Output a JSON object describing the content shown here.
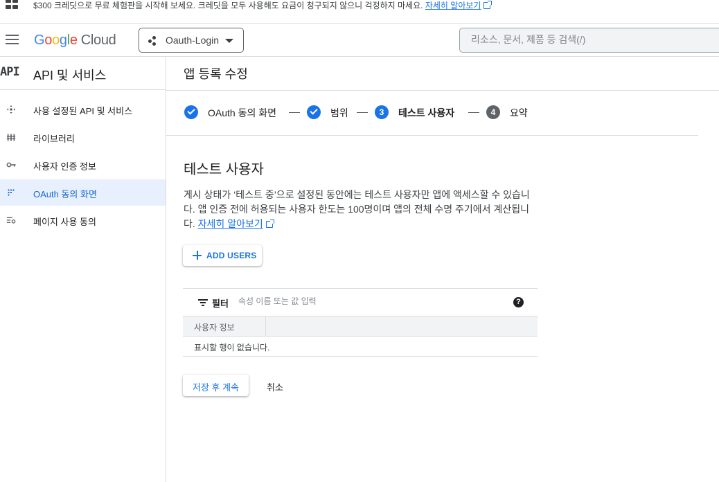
{
  "banner": {
    "text": "$300 크레딧으로 무료 체험판을 시작해 보세요. 크레딧을 모두 사용해도 요금이 청구되지 않으니 걱정하지 마세요.",
    "link": "자세히 알아보기"
  },
  "header": {
    "logo_google": [
      "G",
      "o",
      "o",
      "g",
      "l",
      "e"
    ],
    "logo_cloud": "Cloud",
    "project_name": "Oauth-Login",
    "search_placeholder": "리소스, 문서, 제품 등 검색(/)"
  },
  "sidebar": {
    "badge": "API",
    "title": "API 및 서비스",
    "items": [
      {
        "label": "사용 설정된 API 및 서비스",
        "icon": "api-services-icon"
      },
      {
        "label": "라이브러리",
        "icon": "library-icon"
      },
      {
        "label": "사용자 인증 정보",
        "icon": "key-icon"
      },
      {
        "label": "OAuth 동의 화면",
        "icon": "consent-screen-icon",
        "active": true
      },
      {
        "label": "페이지 사용 동의",
        "icon": "page-usage-icon"
      }
    ]
  },
  "main": {
    "title": "앱 등록 수정",
    "steps": [
      {
        "label": "OAuth 동의 화면",
        "state": "done"
      },
      {
        "label": "범위",
        "state": "done"
      },
      {
        "number": "3",
        "label": "테스트 사용자",
        "state": "current"
      },
      {
        "number": "4",
        "label": "요약",
        "state": "todo"
      }
    ],
    "section_title": "테스트 사용자",
    "description": "게시 상태가 ‘테스트 중’으로 설정된 동안에는 테스트 사용자만 앱에 액세스할 수 있습니다. 앱 인증 전에 허용되는 사용자 한도는 100명이며 앱의 전체 수명 주기에서 계산됩니다. ",
    "description_link": "자세히 알아보기",
    "add_users_label": "ADD USERS",
    "table": {
      "filter_label": "필터",
      "filter_placeholder": "속성 이름 또는 값 입력",
      "help": "?",
      "columns": [
        "사용자 정보"
      ],
      "empty_text": "표시할 행이 없습니다."
    },
    "save_label": "저장 후 계속",
    "cancel_label": "취소"
  },
  "colors": {
    "accent": "#1a73e8",
    "active_bg": "#e8f0fe",
    "border": "#dadce0"
  }
}
